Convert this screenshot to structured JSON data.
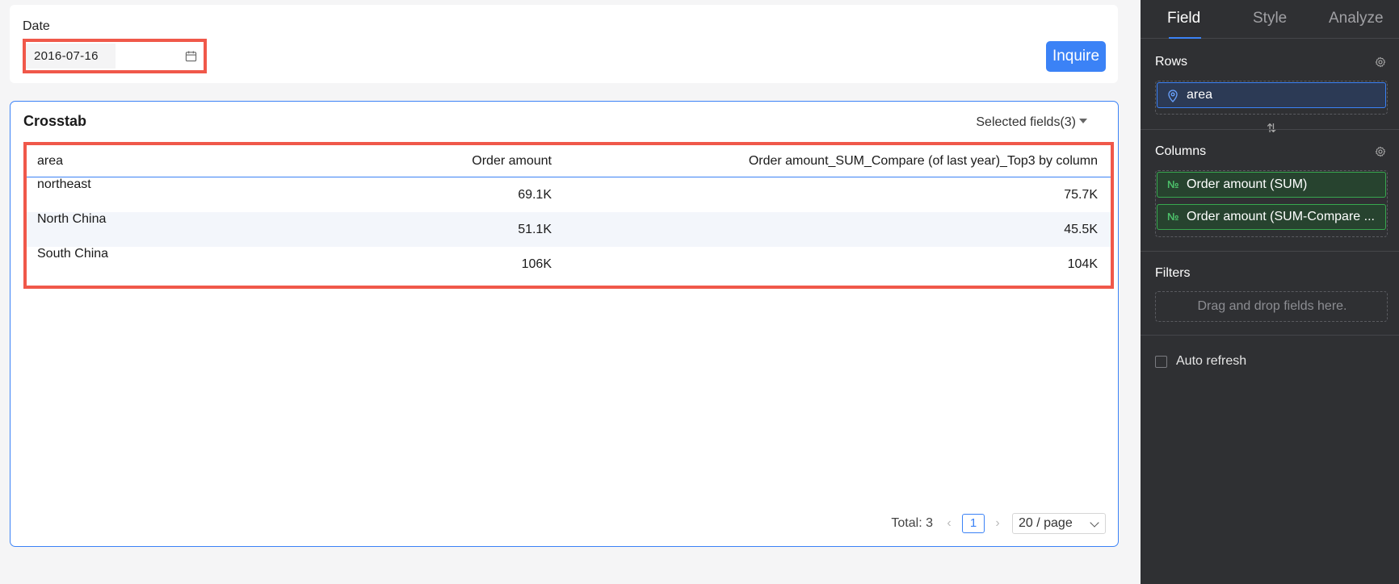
{
  "filter": {
    "label": "Date",
    "date_value": "2016-07-16",
    "inquire_label": "Inquire"
  },
  "crosstab": {
    "title": "Crosstab",
    "selected_fields_label": "Selected fields(3)",
    "columns": [
      "area",
      "Order amount",
      "Order amount_SUM_Compare (of last year)_Top3 by column"
    ],
    "rows": [
      [
        "northeast",
        "69.1K",
        "75.7K"
      ],
      [
        "North China",
        "51.1K",
        "45.5K"
      ],
      [
        "South China",
        "106K",
        "104K"
      ]
    ],
    "pagination": {
      "total_label": "Total: 3",
      "current_page": "1",
      "page_size_label": "20 / page"
    }
  },
  "panel": {
    "tabs": [
      "Field",
      "Style",
      "Analyze"
    ],
    "active_tab": "Field",
    "rows_title": "Rows",
    "row_fields": [
      "area"
    ],
    "columns_title": "Columns",
    "column_fields": [
      "Order amount (SUM)",
      "Order amount (SUM-Compare ..."
    ],
    "filters_title": "Filters",
    "filters_placeholder": "Drag and drop fields here.",
    "auto_refresh_label": "Auto refresh",
    "auto_refresh_checked": false
  },
  "colors": {
    "accent": "#3b82f6",
    "highlight": "#f0584a",
    "panel_bg": "#2f3033",
    "measure_green": "#38a84f"
  }
}
